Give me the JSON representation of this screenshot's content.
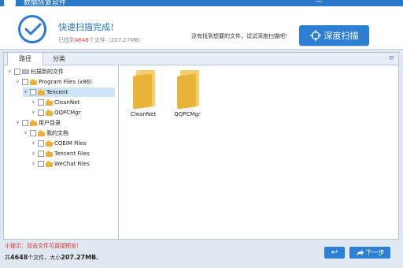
{
  "window": {
    "title": "数据恢复软件"
  },
  "status": {
    "title": "快速扫描完成！",
    "found_prefix": "已找到",
    "found_count": "4648",
    "found_suffix": "个文件（207.27MB）"
  },
  "hint": "没有找到想要的文件，试试深度扫描吧！",
  "deep_scan": {
    "label": "深度扫描"
  },
  "tabs": [
    {
      "label": "路径"
    },
    {
      "label": "分类"
    }
  ],
  "tree": [
    {
      "label": "扫描到的文件",
      "kind": "drive"
    },
    {
      "label": "Program Files (x86)",
      "kind": "folder"
    },
    {
      "label": "Tencent",
      "kind": "folder",
      "selected": true
    },
    {
      "label": "CleanNet",
      "kind": "folder"
    },
    {
      "label": "QQPCMgr",
      "kind": "folder"
    },
    {
      "label": "用户目录",
      "kind": "folder"
    },
    {
      "label": "我的文档",
      "kind": "folder"
    },
    {
      "label": "CQEIM Files",
      "kind": "folder"
    },
    {
      "label": "Tencent Files",
      "kind": "folder"
    },
    {
      "label": "WeChat Files",
      "kind": "folder"
    }
  ],
  "files": [
    {
      "name": "CleanNet"
    },
    {
      "name": "QQPCMgr"
    }
  ],
  "footer": {
    "tip": "小提示：双击文件可直接预览！",
    "total_prefix": "共",
    "total_count": "4648",
    "total_mid": "个文件，大小",
    "total_size": "207.27MB",
    "total_end": "。"
  },
  "buttons": {
    "back_icon": "↩",
    "next_label": "下一步"
  },
  "icons": {
    "check": "check-icon",
    "crosshair": "crosshair-icon",
    "menu": "menu-icon",
    "next": "share-arrow-icon"
  },
  "colors": {
    "accent": "#2d7fd3",
    "highlight": "#e23d3d",
    "tip": "#e0322d"
  }
}
